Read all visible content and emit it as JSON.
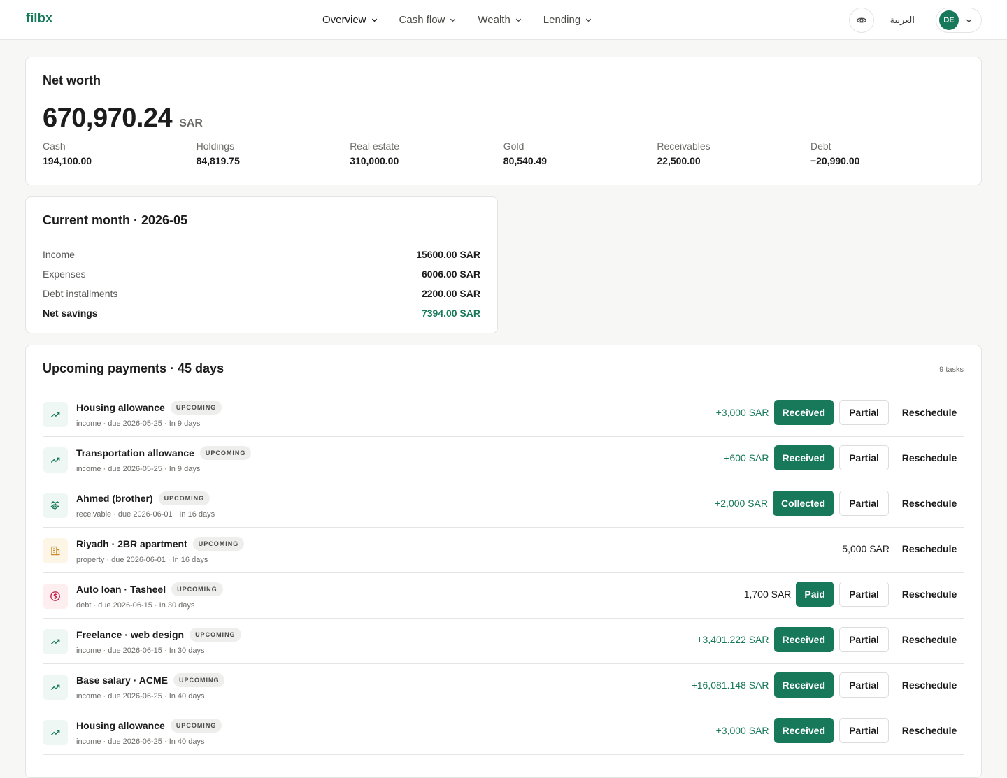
{
  "app": {
    "logo": "filbx"
  },
  "nav": [
    {
      "label": "Overview",
      "active": true
    },
    {
      "label": "Cash flow",
      "active": false
    },
    {
      "label": "Wealth",
      "active": false
    },
    {
      "label": "Lending",
      "active": false
    }
  ],
  "header": {
    "language": "العربية",
    "user_initials": "DE",
    "visibility_icon": "eye-icon"
  },
  "net_worth": {
    "title": "Net worth",
    "value": "670,970.24",
    "currency": "SAR",
    "breakdown": [
      {
        "label": "Cash",
        "value": "194,100.00"
      },
      {
        "label": "Holdings",
        "value": "84,819.75"
      },
      {
        "label": "Real estate",
        "value": "310,000.00"
      },
      {
        "label": "Gold",
        "value": "80,540.49"
      },
      {
        "label": "Receivables",
        "value": "22,500.00"
      },
      {
        "label": "Debt",
        "value": "−20,990.00"
      }
    ]
  },
  "current_month": {
    "title": "Current month · 2026-05",
    "rows": [
      {
        "label": "Income",
        "value": "15600.00 SAR"
      },
      {
        "label": "Expenses",
        "value": "6006.00 SAR"
      },
      {
        "label": "Debt installments",
        "value": "2200.00 SAR"
      },
      {
        "label": "Net savings",
        "value": "7394.00 SAR"
      }
    ]
  },
  "upcoming": {
    "title": "Upcoming payments · 45 days",
    "count": "9 tasks",
    "items": [
      {
        "name": "Housing allowance",
        "badge": "UPCOMING",
        "sub": "income · due 2026-05-25 · In 9 days",
        "amount": "+3,000 SAR",
        "type": "income",
        "icon": "trending-up-icon",
        "primary": "Received",
        "partial": "Partial",
        "reschedule": "Reschedule"
      },
      {
        "name": "Transportation allowance",
        "badge": "UPCOMING",
        "sub": "income · due 2026-05-25 · In 9 days",
        "amount": "+600 SAR",
        "type": "income",
        "icon": "trending-up-icon",
        "primary": "Received",
        "partial": "Partial",
        "reschedule": "Reschedule"
      },
      {
        "name": "Ahmed (brother)",
        "badge": "UPCOMING",
        "sub": "receivable · due 2026-06-01 · In 16 days",
        "amount": "+2,000 SAR",
        "type": "receivable",
        "icon": "handshake-icon",
        "primary": "Collected",
        "partial": "Partial",
        "reschedule": "Reschedule"
      },
      {
        "name": "Riyadh · 2BR apartment",
        "badge": "UPCOMING",
        "sub": "property · due 2026-06-01 · In 16 days",
        "amount": "5,000 SAR",
        "type": "property",
        "icon": "building-icon",
        "primary": "",
        "partial": "",
        "reschedule": "Reschedule"
      },
      {
        "name": "Auto loan · Tasheel",
        "badge": "UPCOMING",
        "sub": "debt · due 2026-06-15 · In 30 days",
        "amount": "1,700 SAR",
        "type": "debt",
        "icon": "dollar-circle-icon",
        "primary": "Paid",
        "partial": "Partial",
        "reschedule": "Reschedule"
      },
      {
        "name": "Freelance · web design",
        "badge": "UPCOMING",
        "sub": "income · due 2026-06-15 · In 30 days",
        "amount": "+3,401.222 SAR",
        "type": "income",
        "icon": "trending-up-icon",
        "primary": "Received",
        "partial": "Partial",
        "reschedule": "Reschedule"
      },
      {
        "name": "Base salary · ACME",
        "badge": "UPCOMING",
        "sub": "income · due 2026-06-25 · In 40 days",
        "amount": "+16,081.148 SAR",
        "type": "income",
        "icon": "trending-up-icon",
        "primary": "Received",
        "partial": "Partial",
        "reschedule": "Reschedule"
      },
      {
        "name": "Housing allowance",
        "badge": "UPCOMING",
        "sub": "income · due 2026-06-25 · In 40 days",
        "amount": "+3,000 SAR",
        "type": "income",
        "icon": "trending-up-icon",
        "primary": "Received",
        "partial": "Partial",
        "reschedule": "Reschedule"
      }
    ]
  },
  "colors": {
    "accent": "#17795a",
    "debt_icon": "#c8244a",
    "property_icon": "#c8892a"
  }
}
